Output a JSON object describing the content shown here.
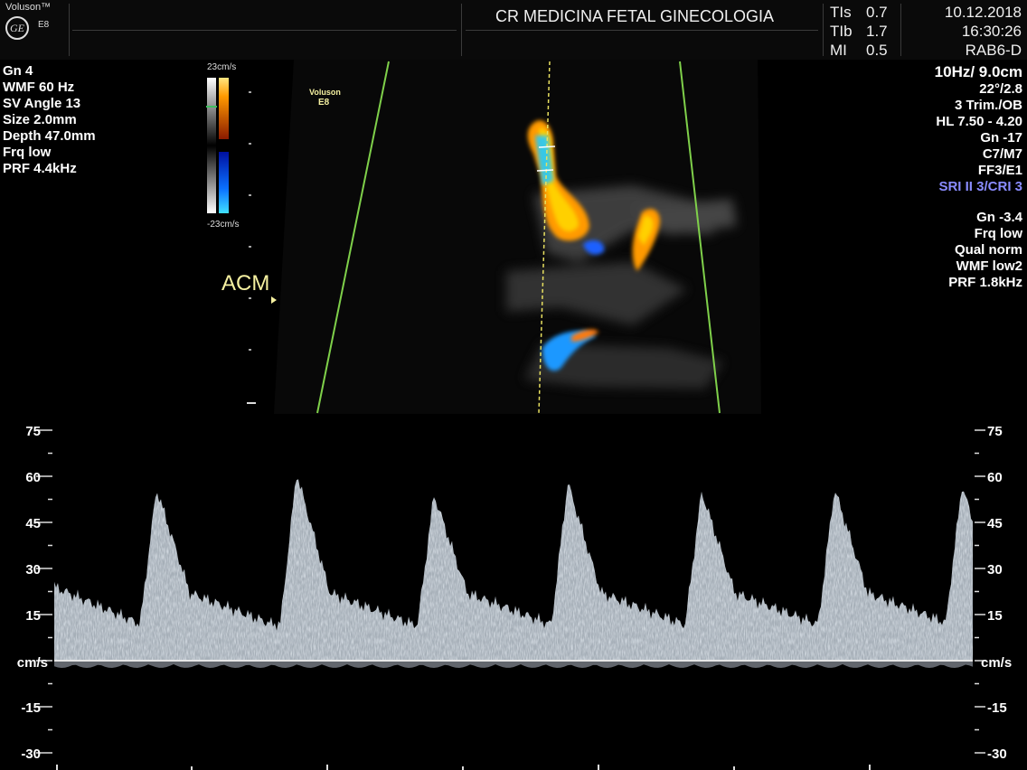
{
  "brand": {
    "name": "Voluson™",
    "model": "E8",
    "logo": "GE"
  },
  "header": {
    "institution": "CR MEDICINA FETAL GINECOLOGIA",
    "indices": [
      {
        "label": "TIs",
        "value": "0.7"
      },
      {
        "label": "TIb",
        "value": "1.7"
      },
      {
        "label": "MI",
        "value": "0.5"
      }
    ],
    "date": "10.12.2018",
    "time": "16:30:26",
    "probe": "RAB6-D"
  },
  "left_params": [
    "Gn  4",
    "WMF 60 Hz",
    "SV Angle 13",
    "Size  2.0mm",
    "Depth 47.0mm",
    "Frq low",
    "PRF  4.4kHz"
  ],
  "color_scale": {
    "top": "23cm/s",
    "bottom": "-23cm/s"
  },
  "watermark": {
    "line1": "Voluson",
    "line2": "E8"
  },
  "vessel_label": "ACM",
  "right_params": [
    "10Hz/ 9.0cm",
    "22°/2.8",
    "3 Trim./OB",
    "HL  7.50 - 4.20",
    "Gn -17",
    "C7/M7",
    "FF3/E1"
  ],
  "right_params_highlight": "SRI II 3/CRI 3",
  "right_params2": [
    "Gn -3.4",
    "Frq low",
    "Qual norm",
    "WMF low2",
    "PRF  1.8kHz"
  ],
  "spectral_axis": {
    "unit": "cm/s",
    "ticks_pos": [
      "75",
      "60",
      "45",
      "30",
      "15"
    ],
    "ticks_neg": [
      "-15",
      "-30"
    ]
  },
  "colors": {
    "overlay_text": "#f5f0a0",
    "highlight_text": "#8a8cff",
    "sector_lines": "#7fd04a",
    "doppler_red": "#ff8a00",
    "doppler_blue": "#19a0ff"
  }
}
